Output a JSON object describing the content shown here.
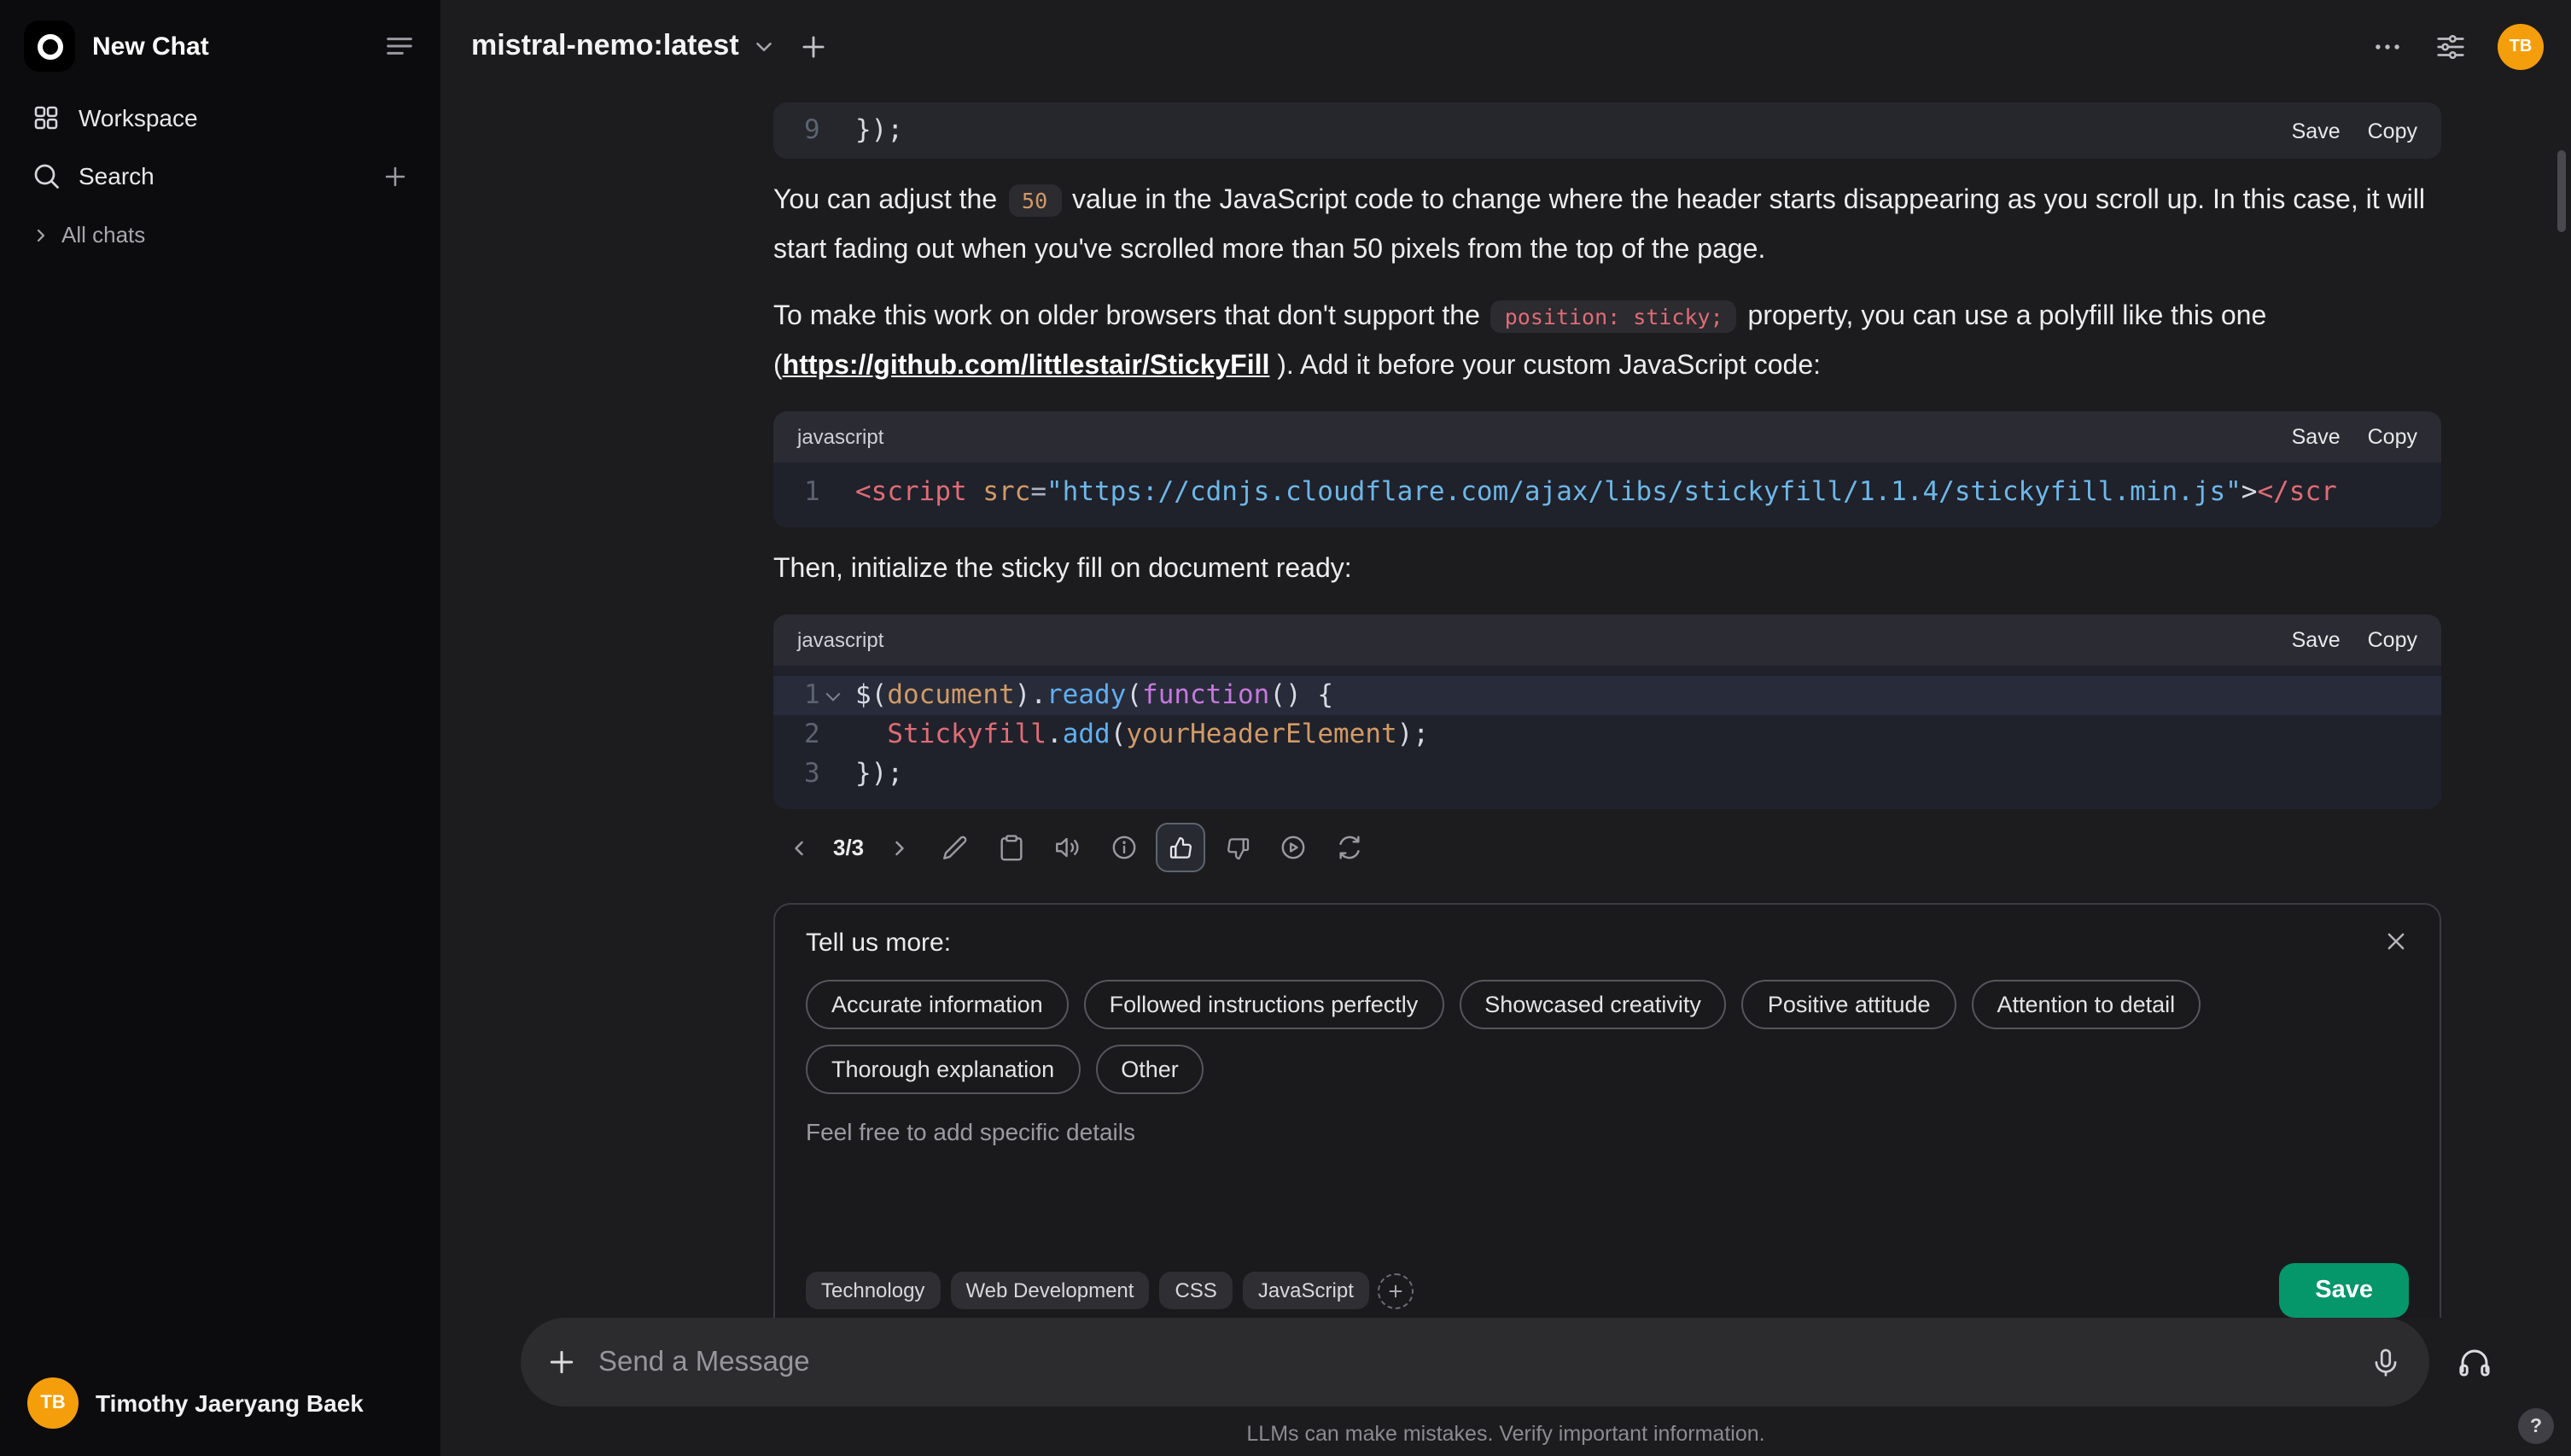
{
  "colors": {
    "accent_green": "#059669",
    "avatar_orange": "#f59e0b"
  },
  "sidebar": {
    "app_title": "New Chat",
    "workspace_label": "Workspace",
    "search_label": "Search",
    "all_chats_label": "All chats",
    "user": {
      "name": "Timothy Jaeryang Baek",
      "initials": "TB"
    }
  },
  "header": {
    "model_name": "mistral-nemo:latest",
    "avatar_initials": "TB"
  },
  "chat": {
    "code_partial": {
      "save_label": "Save",
      "copy_label": "Copy",
      "lines": [
        {
          "no": "9",
          "tokens": [
            [
              "});",
              "#d7dae2"
            ]
          ]
        }
      ]
    },
    "para1": {
      "text_before": "You can adjust the ",
      "inline_code": "50",
      "text_after": " value in the JavaScript code to change where the header starts disappearing as you scroll up. In this case, it will start fading out when you've scrolled more than 50 pixels from the top of the page."
    },
    "para2": {
      "text_before": "To make this work on older browsers that don't support the ",
      "inline_code": "position: sticky;",
      "text_mid": " property, you can use a polyfill like this one (",
      "link_text": "https://github.com/littlestair/StickyFill",
      "text_after": " ). Add it before your custom JavaScript code:"
    },
    "code1": {
      "lang": "javascript",
      "save_label": "Save",
      "copy_label": "Copy",
      "lines": [
        {
          "no": "1",
          "tokens": [
            [
              "<script ",
              "#e06c75"
            ],
            [
              "src",
              "#d19a66"
            ],
            [
              "=",
              "#abb2bf"
            ],
            [
              "\"https://cdnjs.cloudflare.com/ajax/libs/stickyfill/1.1.4/stickyfill.min.js\"",
              "#6db8e8"
            ],
            [
              ">",
              "#d7dae2"
            ],
            [
              "</scr",
              "#e06c75"
            ]
          ]
        }
      ]
    },
    "para3": "Then, initialize the sticky fill on document ready:",
    "code2": {
      "lang": "javascript",
      "save_label": "Save",
      "copy_label": "Copy",
      "lines": [
        {
          "no": "1",
          "fold": true,
          "hl": true,
          "tokens": [
            [
              "$(",
              "#d7dae2"
            ],
            [
              "document",
              "#d19a66"
            ],
            [
              ").",
              "#d7dae2"
            ],
            [
              "ready",
              "#61afef"
            ],
            [
              "(",
              "#d7dae2"
            ],
            [
              "function",
              "#c678dd"
            ],
            [
              "() {",
              "#d7dae2"
            ]
          ]
        },
        {
          "no": "2",
          "tokens": [
            [
              "  ",
              "#d7dae2"
            ],
            [
              "Stickyfill",
              "#e06c75"
            ],
            [
              ".",
              "#d7dae2"
            ],
            [
              "add",
              "#61afef"
            ],
            [
              "(",
              "#d7dae2"
            ],
            [
              "yourHeaderElement",
              "#d19a66"
            ],
            [
              ");",
              "#d7dae2"
            ]
          ]
        },
        {
          "no": "3",
          "tokens": [
            [
              "});",
              "#d7dae2"
            ]
          ]
        }
      ]
    },
    "pager": "3/3",
    "feedback": {
      "title": "Tell us more:",
      "options": [
        "Accurate information",
        "Followed instructions perfectly",
        "Showcased creativity",
        "Positive attitude",
        "Attention to detail",
        "Thorough explanation",
        "Other"
      ],
      "details_placeholder": "Feel free to add specific details",
      "tags": [
        "Technology",
        "Web Development",
        "CSS",
        "JavaScript"
      ],
      "save_label": "Save"
    }
  },
  "composer": {
    "placeholder": "Send a Message"
  },
  "footer": {
    "disclaimer": "LLMs can make mistakes. Verify important information.",
    "help_label": "?"
  }
}
